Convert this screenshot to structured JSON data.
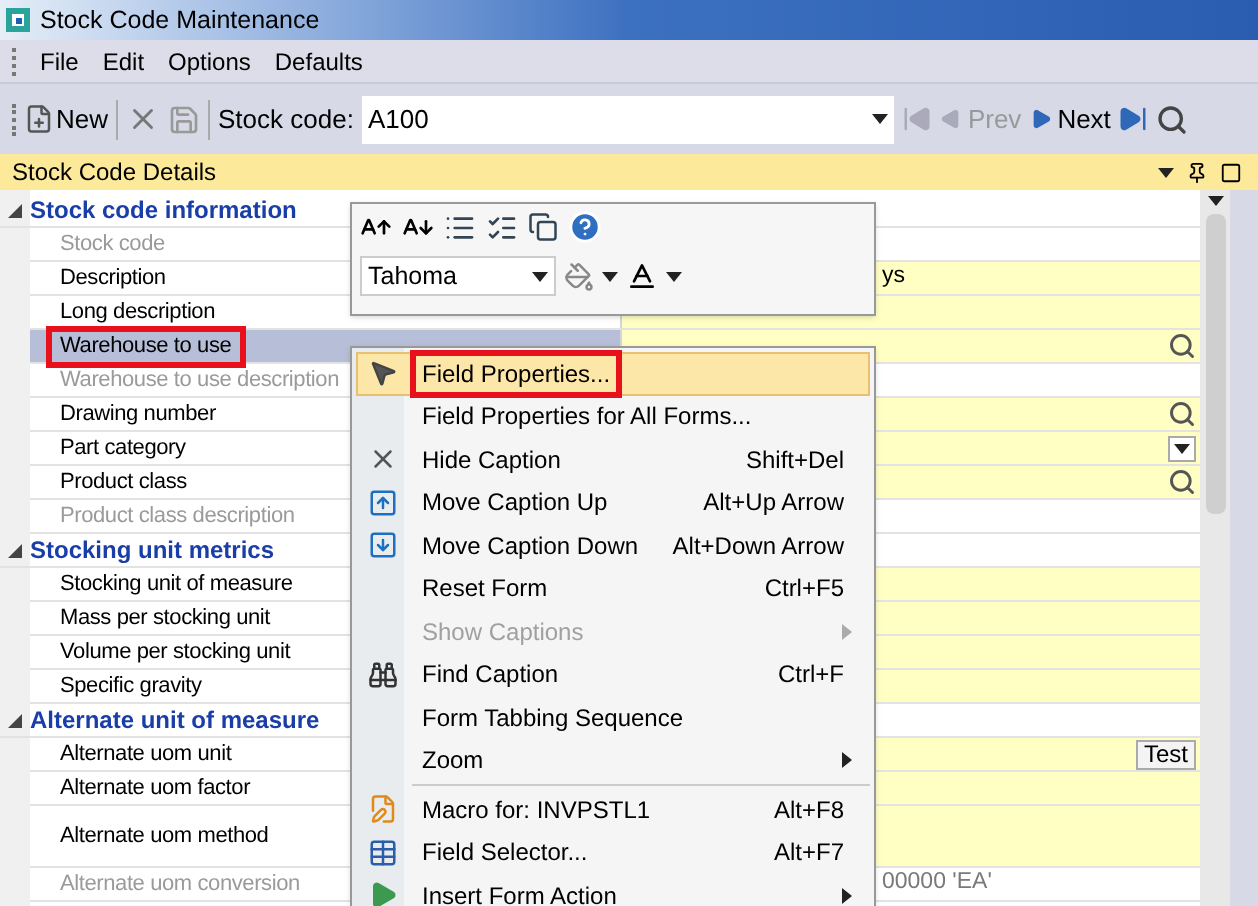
{
  "window": {
    "title": "Stock Code Maintenance"
  },
  "menu_bar": [
    "File",
    "Edit",
    "Options",
    "Defaults"
  ],
  "toolbar": {
    "new": "New",
    "stock_code_label": "Stock code:",
    "stock_code_value": "A100",
    "prev": "Prev",
    "next": "Next"
  },
  "panel": {
    "title": "Stock Code Details"
  },
  "groups": [
    {
      "title": "Stock code information",
      "expanded": true,
      "rows": [
        {
          "label": "Stock code",
          "kind": "plain",
          "editable": false,
          "disabled": true,
          "selected": false,
          "annotated": false
        },
        {
          "label": "Description",
          "kind": "plain",
          "editable": true,
          "disabled": false,
          "selected": false,
          "annotated": false,
          "value": "ys"
        },
        {
          "label": "Long description",
          "kind": "plain",
          "editable": true,
          "disabled": false,
          "selected": false,
          "annotated": false
        },
        {
          "label": "Warehouse to use",
          "kind": "lookup",
          "editable": true,
          "disabled": false,
          "selected": true,
          "annotated": true
        },
        {
          "label": "Warehouse to use description",
          "kind": "plain",
          "editable": false,
          "disabled": true,
          "selected": false,
          "annotated": false
        },
        {
          "label": "Drawing number",
          "kind": "lookup",
          "editable": true,
          "disabled": false,
          "selected": false,
          "annotated": false
        },
        {
          "label": "Part category",
          "kind": "dropdown",
          "editable": true,
          "disabled": false,
          "selected": false,
          "annotated": false
        },
        {
          "label": "Product class",
          "kind": "lookup",
          "editable": true,
          "disabled": false,
          "selected": false,
          "annotated": false
        },
        {
          "label": "Product class description",
          "kind": "plain",
          "editable": false,
          "disabled": true,
          "selected": false,
          "annotated": false
        }
      ]
    },
    {
      "title": "Stocking unit metrics",
      "expanded": true,
      "rows": [
        {
          "label": "Stocking unit of measure",
          "kind": "plain",
          "editable": true,
          "disabled": false,
          "selected": false,
          "annotated": false
        },
        {
          "label": "Mass per stocking unit",
          "kind": "plain",
          "editable": true,
          "disabled": false,
          "selected": false,
          "annotated": false
        },
        {
          "label": "Volume per stocking unit",
          "kind": "plain",
          "editable": true,
          "disabled": false,
          "selected": false,
          "annotated": false
        },
        {
          "label": "Specific gravity",
          "kind": "plain",
          "editable": true,
          "disabled": false,
          "selected": false,
          "annotated": false
        }
      ]
    },
    {
      "title": "Alternate unit of measure",
      "expanded": true,
      "rows": [
        {
          "label": "Alternate uom unit",
          "kind": "button",
          "button": "Test",
          "editable": true,
          "disabled": false,
          "selected": false,
          "annotated": false
        },
        {
          "label": "Alternate uom factor",
          "kind": "plain",
          "editable": true,
          "disabled": false,
          "selected": false,
          "annotated": false
        },
        {
          "label": "Alternate uom method",
          "kind": "multiline",
          "editable": true,
          "disabled": false,
          "selected": false,
          "annotated": false
        },
        {
          "label": "Alternate uom conversion",
          "kind": "plain",
          "editable": false,
          "disabled": true,
          "selected": false,
          "annotated": false,
          "value": "00000 'EA'"
        }
      ]
    }
  ],
  "mini_toolbar": {
    "font": "Tahoma"
  },
  "context_menu": [
    {
      "kind": "item",
      "label": "Field Properties...",
      "submenu": false,
      "disabled": false,
      "selected": true,
      "annotated": true
    },
    {
      "kind": "item",
      "label": "Field Properties for All Forms...",
      "submenu": false,
      "disabled": false,
      "selected": false,
      "annotated": false
    },
    {
      "kind": "item",
      "label": "Hide Caption",
      "shortcut": "Shift+Del",
      "submenu": false,
      "disabled": false,
      "selected": false,
      "annotated": false
    },
    {
      "kind": "item",
      "label": "Move Caption Up",
      "shortcut": "Alt+Up Arrow",
      "submenu": false,
      "disabled": false,
      "selected": false,
      "annotated": false
    },
    {
      "kind": "item",
      "label": "Move Caption Down",
      "shortcut": "Alt+Down Arrow",
      "submenu": false,
      "disabled": false,
      "selected": false,
      "annotated": false
    },
    {
      "kind": "item",
      "label": "Reset Form",
      "shortcut": "Ctrl+F5",
      "submenu": false,
      "disabled": false,
      "selected": false,
      "annotated": false
    },
    {
      "kind": "item",
      "label": "Show Captions",
      "submenu": true,
      "disabled": true,
      "selected": false,
      "annotated": false
    },
    {
      "kind": "item",
      "label": "Find Caption",
      "shortcut": "Ctrl+F",
      "submenu": false,
      "disabled": false,
      "selected": false,
      "annotated": false
    },
    {
      "kind": "item",
      "label": "Form Tabbing Sequence",
      "submenu": false,
      "disabled": false,
      "selected": false,
      "annotated": false
    },
    {
      "kind": "item",
      "label": "Zoom",
      "submenu": true,
      "disabled": false,
      "selected": false,
      "annotated": false
    },
    {
      "kind": "separator"
    },
    {
      "kind": "item",
      "label": "Macro for: INVPSTL1",
      "shortcut": "Alt+F8",
      "submenu": false,
      "disabled": false,
      "selected": false,
      "annotated": false
    },
    {
      "kind": "item",
      "label": "Field Selector...",
      "shortcut": "Alt+F7",
      "submenu": false,
      "disabled": false,
      "selected": false,
      "annotated": false
    },
    {
      "kind": "item",
      "label": "Insert Form Action",
      "submenu": true,
      "disabled": false,
      "selected": false,
      "annotated": false
    }
  ]
}
